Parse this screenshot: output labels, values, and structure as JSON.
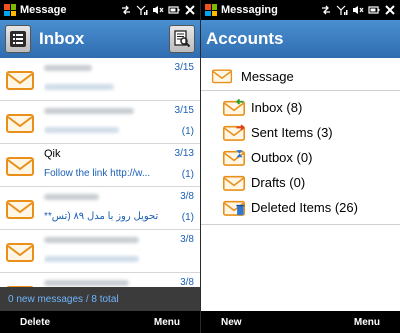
{
  "left": {
    "status_title": "Message",
    "inbox_title": "Inbox",
    "messages": [
      {
        "from": "",
        "subject": "",
        "date": "3/15",
        "count": ""
      },
      {
        "from": "",
        "subject": "",
        "date": "3/15",
        "count": "(1)"
      },
      {
        "from": "Qik",
        "subject": "Follow the link http://w...",
        "date": "3/13",
        "count": "(1)"
      },
      {
        "from": "",
        "subject": "تحویل روز با مدل ۸۹ (تس**",
        "date": "3/8",
        "count": "(1)"
      },
      {
        "from": "",
        "subject": "",
        "date": "3/8",
        "count": ""
      },
      {
        "from": "",
        "subject": "",
        "date": "3/8",
        "count": ""
      }
    ],
    "footer_info": "0 new messages / 8 total",
    "softkey_left": "Delete",
    "softkey_right": "Menu"
  },
  "right": {
    "status_title": "Messaging",
    "accounts_title": "Accounts",
    "account_name": "Message",
    "folders": [
      {
        "label": "Inbox (8)",
        "icon": "inbox-icon"
      },
      {
        "label": "Sent Items (3)",
        "icon": "sent-items-icon"
      },
      {
        "label": "Outbox (0)",
        "icon": "outbox-icon"
      },
      {
        "label": "Drafts (0)",
        "icon": "drafts-icon"
      },
      {
        "label": "Deleted Items (26)",
        "icon": "deleted-items-icon"
      }
    ],
    "softkey_left": "New",
    "softkey_right": "Menu"
  },
  "colors": {
    "titlebar": "#3a7cc0",
    "link_blue": "#1a5fb4",
    "envelope": "#f29a1f"
  }
}
